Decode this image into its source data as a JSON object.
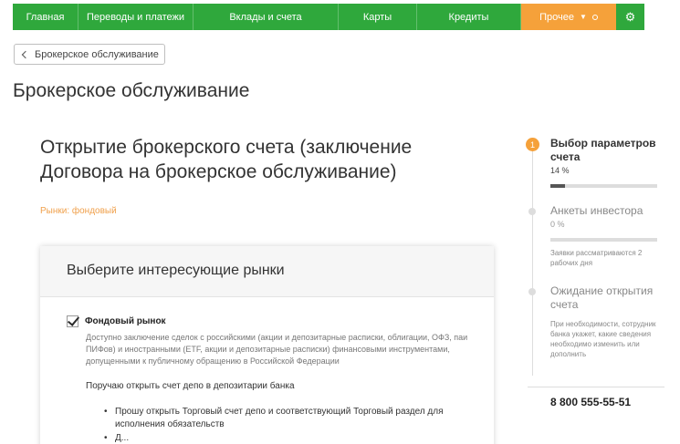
{
  "nav": {
    "items": [
      "Главная",
      "Переводы и платежи",
      "Вклады и счета",
      "Карты",
      "Кредиты"
    ],
    "other_label": "Прочее",
    "gear_icon": "gear-icon",
    "other_color": "#f5a13a",
    "nav_color": "#2fa83c"
  },
  "back_button": {
    "label": "Брокерское обслуживание"
  },
  "page_title": "Брокерское обслуживание",
  "main": {
    "heading": "Открытие брокерского счета (заключение Договора на брокерское обслуживание)",
    "breadcrumb": "Рынки: фондовый"
  },
  "card": {
    "title": "Выберите интересующие рынки",
    "checkbox_label": "Фондовый рынок",
    "checkbox_checked": true,
    "description": "Доступно заключение сделок с российскими (акции и депозитарные расписки, облигации, ОФЗ, паи ПИФов) и иностранными (ETF, акции и депозитарные расписки) финансовыми инструментами, допущенными к публичному обращению в Российской Федерации",
    "instruction": "Поручаю открыть счет депо в депозитарии банка",
    "bullet1": "Прошу открыть Торговый счет депо и соответствующий Торговый раздел для исполнения обязательств",
    "bullet2": "Д..."
  },
  "steps": {
    "step1": {
      "number": "1",
      "title": "Выбор параметров счета",
      "progress": "14 %",
      "progress_value": 14
    },
    "step2": {
      "title": "Анкеты инвестора",
      "progress": "0 %",
      "progress_value": 0,
      "note": "Заявки рассматриваются 2 рабочих дня"
    },
    "step3": {
      "title": "Ожидание открытия счета",
      "note": "При необходимости, сотрудник банка укажет, какие сведения необходимо изменить или дополнить"
    }
  },
  "phone": "8 800 555-55-51"
}
